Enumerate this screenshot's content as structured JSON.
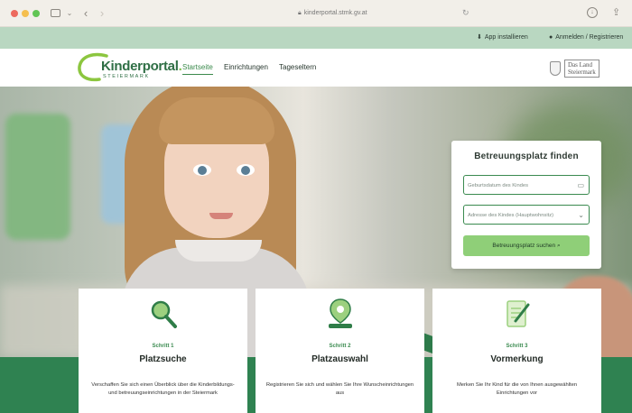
{
  "browser": {
    "url": "kinderportal.stmk.gv.at"
  },
  "utility_bar": {
    "app_install": "App installieren",
    "login": "Anmelden / Registrieren"
  },
  "header": {
    "logo_main": "Kinderportal",
    "logo_dot": ".",
    "logo_sub": "STEIERMARK",
    "nav": [
      {
        "label": "Startseite",
        "active": true
      },
      {
        "label": "Einrichtungen",
        "active": false
      },
      {
        "label": "Tageseltern",
        "active": false
      }
    ],
    "partner_logo": "Das Land Steiermark",
    "partner_line1": "Das Land",
    "partner_line2": "Steiermark"
  },
  "search": {
    "title": "Betreuungsplatz finden",
    "birthdate_placeholder": "Geburtsdatum des Kindes",
    "address_placeholder": "Adresse des Kindes (Hauptwohnsitz)",
    "button_label": "Betreuungsplatz suchen"
  },
  "steps": [
    {
      "label": "Schritt 1",
      "title": "Platzsuche",
      "text": "Verschaffen Sie sich einen Überblick über die Kinderbildungs- und betreuungseinrichtungen in der Steiermark",
      "icon": "magnifier-icon"
    },
    {
      "label": "Schritt 2",
      "title": "Platzauswahl",
      "text": "Registrieren Sie sich und wählen Sie Ihre Wunscheinrichtungen aus",
      "icon": "location-pin-icon"
    },
    {
      "label": "Schritt 3",
      "title": "Vormerkung",
      "text": "Merken Sie Ihr Kind für die von Ihnen ausgewählten Einrichtungen vor",
      "icon": "document-pen-icon"
    }
  ],
  "colors": {
    "brand_green": "#3b8a4c",
    "utility_bar": "#b9d7c1",
    "button_green": "#8fcf78",
    "band_green": "#2f8251"
  }
}
